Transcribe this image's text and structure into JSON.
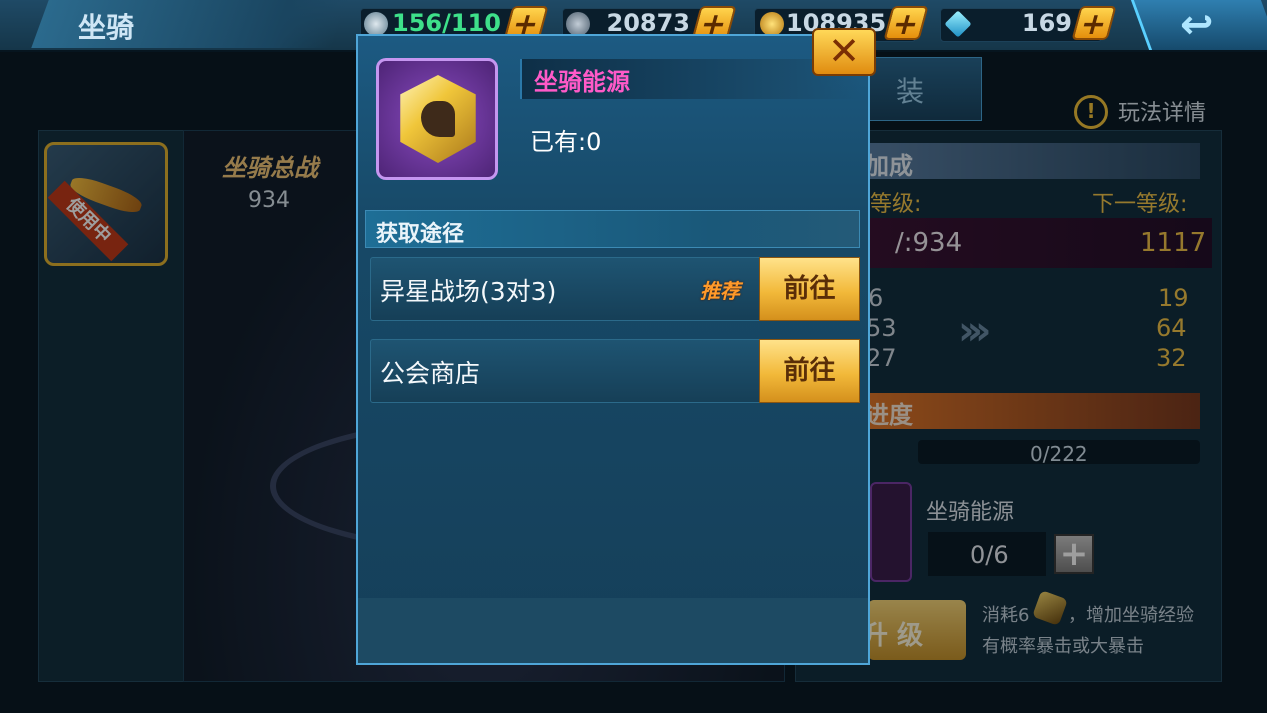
{
  "header": {
    "title": "坐骑",
    "resources": [
      {
        "name": "stamina",
        "icon": "stamina-icon",
        "value": "156/110"
      },
      {
        "name": "silver",
        "icon": "silver-coin-icon",
        "value": "20873"
      },
      {
        "name": "gold",
        "icon": "gold-coin-icon",
        "value": "108935"
      },
      {
        "name": "diamond",
        "icon": "diamond-icon",
        "value": "169"
      }
    ],
    "plus_label": "+",
    "back_icon": "back-arrow-icon"
  },
  "background": {
    "mount_badge": "使用中",
    "total_power_label": "坐骑总战",
    "total_power_value": "934",
    "equip_tab": "装",
    "help_label": "玩法详情",
    "help_icon_text": "!",
    "bonus_title": "加成",
    "level_label": "等级:",
    "next_level_label": "下一等级:",
    "current_power": "/:934",
    "next_power": "1117",
    "stats_current": [
      "6",
      "53",
      "27"
    ],
    "stats_next": [
      "19",
      "64",
      "32"
    ],
    "chevrons": "›››",
    "progress_title": "进度",
    "progress_text": "0/222",
    "progress_fraction": 0,
    "energy_label": "坐骑能源",
    "energy_count": "0/6",
    "energy_plus": "+",
    "upgrade_label": "升 级",
    "consume_text": "消耗6",
    "consume_tail": "，增加坐骑经验",
    "crit_text": "有概率暴击或大暴击"
  },
  "dialog": {
    "item_name": "坐骑能源",
    "owned": "已有:0",
    "close_label": "✕",
    "section_title": "获取途径",
    "routes": [
      {
        "name": "异星战场(3对3)",
        "badge": "推荐",
        "button": "前往"
      },
      {
        "name": "公会商店",
        "badge": "",
        "button": "前往"
      }
    ]
  },
  "colors": {
    "item_name": "#ff5ac8",
    "gold_button": "#f2b93a",
    "recommend": "#ff9a2a"
  }
}
